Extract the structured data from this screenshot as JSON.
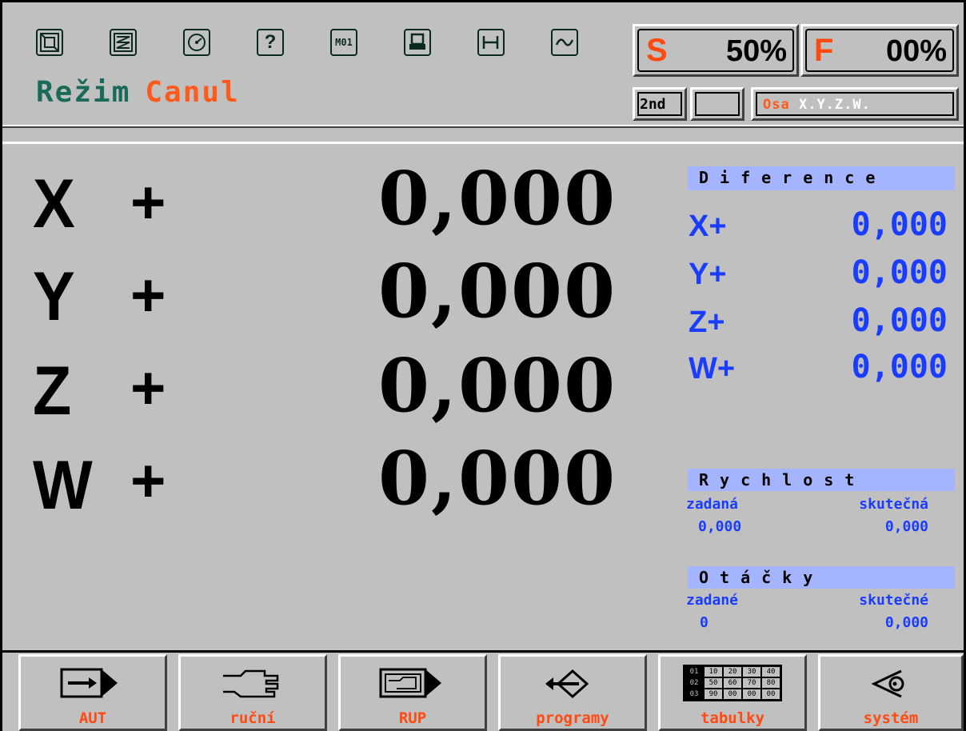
{
  "header": {
    "icons": [
      "mode-cycle-icon",
      "zigzag-icon",
      "dial-icon",
      "help-icon",
      "m01-icon",
      "save-icon",
      "gauge-icon",
      "wave-icon"
    ],
    "mode_key": "Režim",
    "mode_value": "Canul",
    "spindle": {
      "letter": "S",
      "value": "50%"
    },
    "feed": {
      "letter": "F",
      "value": "00%"
    },
    "second_label": "2nd",
    "axis_key": "Osa",
    "axis_value": "X.Y.Z.W.",
    "m01_text": "M01",
    "help_text": "?"
  },
  "main": {
    "axes": [
      {
        "letter": "X",
        "sign": "+",
        "value": "0,000"
      },
      {
        "letter": "Y",
        "sign": "+",
        "value": "0,000"
      },
      {
        "letter": "Z",
        "sign": "+",
        "value": "0,000"
      },
      {
        "letter": "W",
        "sign": "+",
        "value": "0,000"
      }
    ],
    "difference": {
      "title": "Diference",
      "rows": [
        {
          "axis": "X+",
          "value": "0,000"
        },
        {
          "axis": "Y+",
          "value": "0,000"
        },
        {
          "axis": "Z+",
          "value": "0,000"
        },
        {
          "axis": "W+",
          "value": "0,000"
        }
      ]
    },
    "speed": {
      "title": "Rychlost",
      "set_label": "zadaná",
      "actual_label": "skutečná",
      "set_value": "0,000",
      "actual_value": "0,000"
    },
    "rpm": {
      "title": "Otáčky",
      "set_label": "zadané",
      "actual_label": "skutečné",
      "set_value": "0",
      "actual_value": "0,000"
    }
  },
  "footer": {
    "buttons": [
      {
        "label": "AUT",
        "icon": "arrow-right-icon"
      },
      {
        "label": "ruční",
        "icon": "hand-icon"
      },
      {
        "label": "RUP",
        "icon": "hand-program-icon"
      },
      {
        "label": "programy",
        "icon": "exchange-icon"
      },
      {
        "label": "tabulky",
        "icon": "table-icon"
      },
      {
        "label": "systém",
        "icon": "eye-icon"
      }
    ],
    "table_cells": [
      [
        "01",
        "10",
        "20",
        "30",
        "40"
      ],
      [
        "02",
        "50",
        "60",
        "70",
        "80"
      ],
      [
        "03",
        "90",
        "00",
        "00",
        "00"
      ]
    ]
  },
  "colors": {
    "background": "#c0c0c0",
    "accent_orange": "#ff4a10",
    "teal": "#1a6a5a",
    "blue": "#1a3cff",
    "header_band": "#a4b4ff"
  }
}
